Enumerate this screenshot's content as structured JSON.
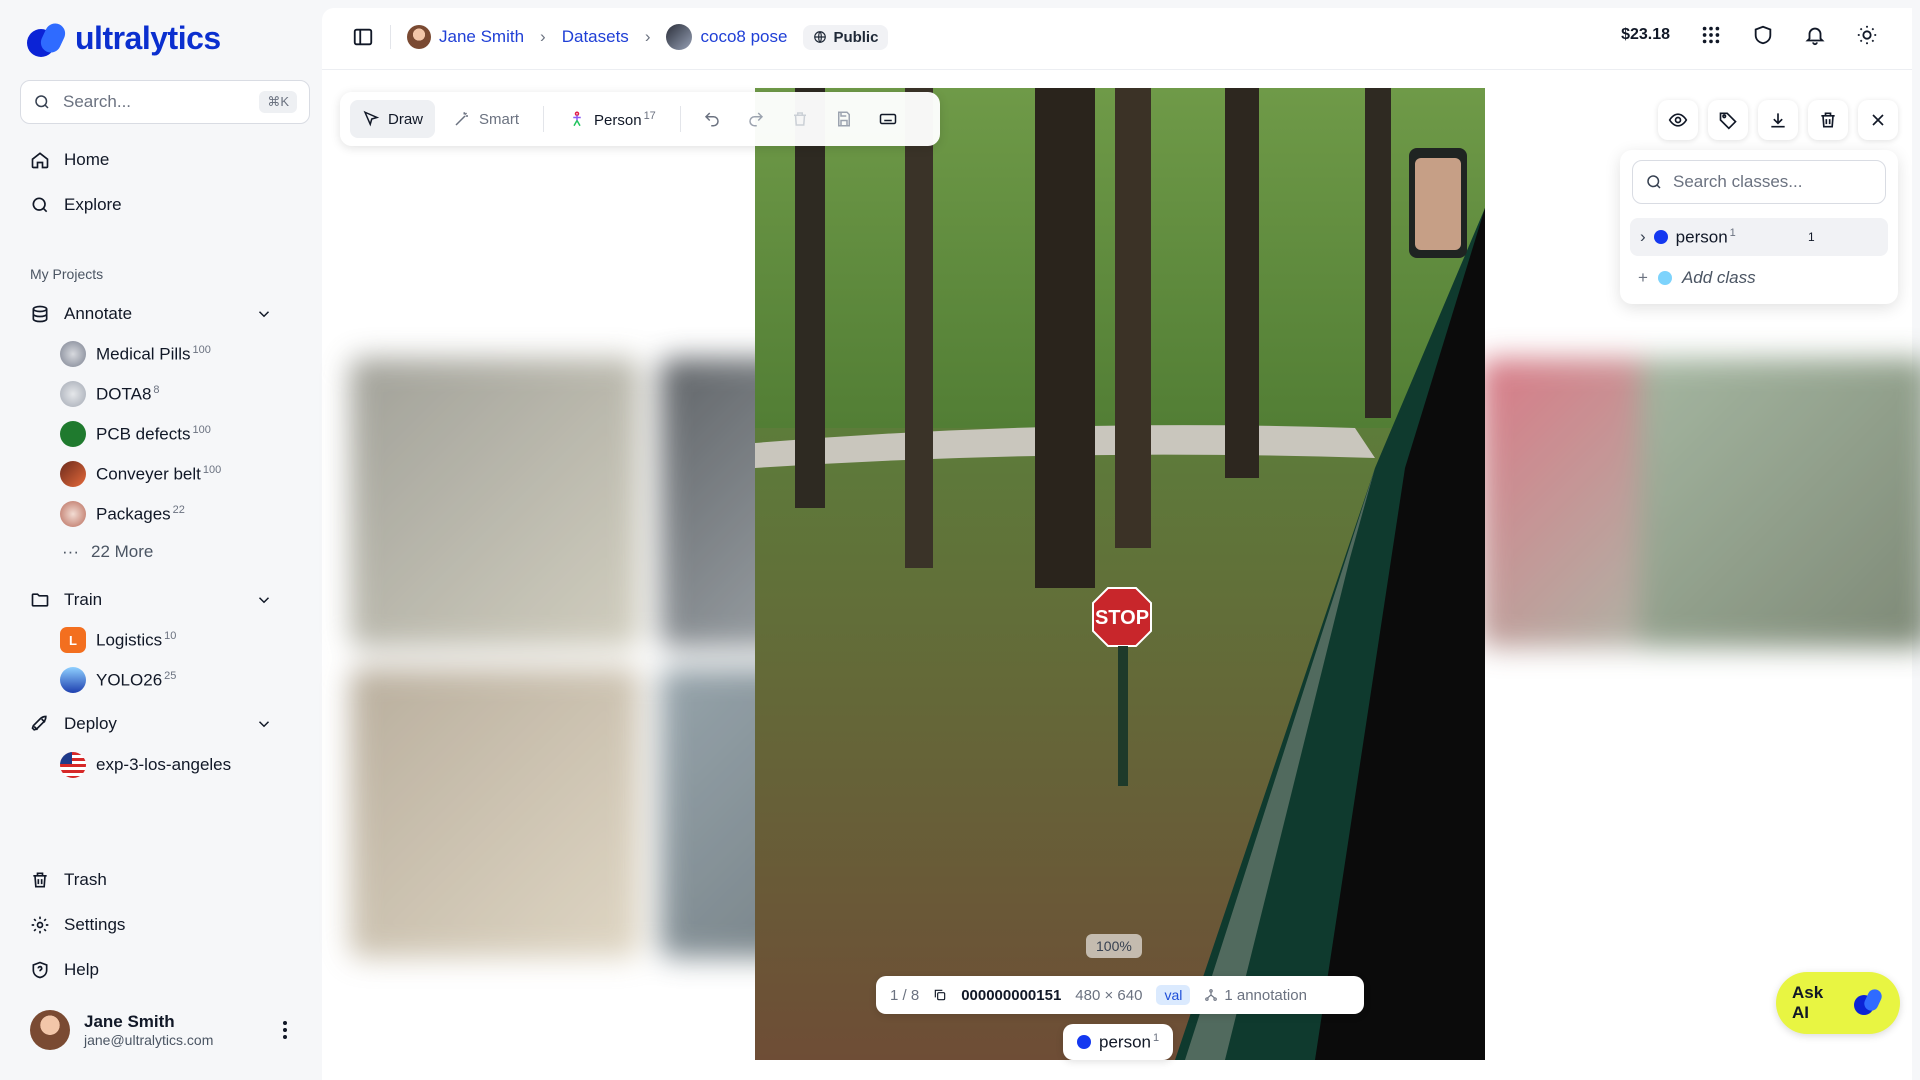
{
  "app": {
    "brand": "ultralytics",
    "brand_color": "#0b2fcf"
  },
  "sidebar": {
    "search_placeholder": "Search...",
    "search_shortcut": "⌘K",
    "nav": [
      {
        "label": "Home",
        "icon": "home-icon"
      },
      {
        "label": "Explore",
        "icon": "search-icon"
      }
    ],
    "section_label": "My Projects",
    "annotate": {
      "label": "Annotate",
      "projects": [
        {
          "label": "Medical Pills",
          "count": "100"
        },
        {
          "label": "DOTA8",
          "count": "8"
        },
        {
          "label": "PCB defects",
          "count": "100"
        },
        {
          "label": "Conveyer belt",
          "count": "100"
        },
        {
          "label": "Packages",
          "count": "22"
        }
      ],
      "more": "22 More"
    },
    "train": {
      "label": "Train",
      "projects": [
        {
          "label": "Logistics",
          "count": "10"
        },
        {
          "label": "YOLO26",
          "count": "25"
        }
      ]
    },
    "deploy": {
      "label": "Deploy",
      "projects": [
        {
          "label": "exp-3-los-angeles"
        }
      ]
    },
    "bottom": [
      {
        "label": "Trash",
        "icon": "trash-icon"
      },
      {
        "label": "Settings",
        "icon": "gear-icon"
      },
      {
        "label": "Help",
        "icon": "help-icon"
      }
    ],
    "user": {
      "name": "Jane Smith",
      "email": "jane@ultralytics.com"
    }
  },
  "topbar": {
    "user": "Jane Smith",
    "datasets": "Datasets",
    "dataset": "coco8 pose",
    "visibility": "Public",
    "balance": "$23.18"
  },
  "toolbar": {
    "draw": "Draw",
    "smart": "Smart",
    "class": "Person",
    "class_count": "17"
  },
  "class_panel": {
    "search_placeholder": "Search classes...",
    "classes": [
      {
        "name": "person",
        "sup": "1",
        "count": "1",
        "color": "#1438f0"
      }
    ],
    "add_class": "Add class"
  },
  "viewer": {
    "zoom": "100%",
    "position": "1 / 8",
    "image_id": "000000000151",
    "dimensions": "480 × 640",
    "split": "val",
    "annotations": "1 annotation",
    "label": "person",
    "label_sup": "1",
    "sign_text": "STOP"
  },
  "ask_ai": {
    "label": "Ask AI",
    "color": "#e8f542"
  }
}
